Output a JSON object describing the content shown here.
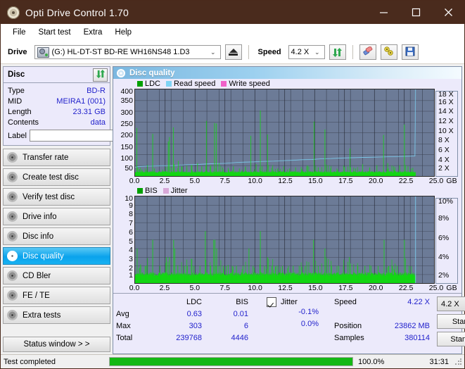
{
  "window": {
    "title": "Opti Drive Control 1.70",
    "icon": "disc-icon",
    "minimize": "─",
    "maximize": "☐",
    "close": "✕",
    "titlebar_color": "#4a2b1d"
  },
  "menu": {
    "items": [
      {
        "label": "File",
        "name": "menu-file"
      },
      {
        "label": "Start test",
        "name": "menu-start-test"
      },
      {
        "label": "Extra",
        "name": "menu-extra"
      },
      {
        "label": "Help",
        "name": "menu-help"
      }
    ]
  },
  "toolbar": {
    "drive_label": "Drive",
    "drive_value": "(G:)   HL-DT-ST BD-RE  WH16NS48 1.D3",
    "eject_icon": "eject-icon",
    "speed_label": "Speed",
    "speed_value": "4.2 X",
    "refresh_icon": "refresh-icon",
    "erase_icon": "eraser-icon",
    "tools_icon": "wrench-icon",
    "save_icon": "floppy-save-icon",
    "caret": "⌄"
  },
  "disc_panel": {
    "title": "Disc",
    "refresh_icon": "refresh-arrows-icon",
    "rows": [
      {
        "key": "Type",
        "value": "BD-R"
      },
      {
        "key": "MID",
        "value": "MEIRA1 (001)"
      },
      {
        "key": "Length",
        "value": "23.31 GB"
      },
      {
        "key": "Contents",
        "value": "data"
      }
    ],
    "label_key": "Label",
    "label_value": "",
    "label_placeholder": "",
    "disc_icon": "cd-disc-icon"
  },
  "nav": {
    "items": [
      {
        "label": "Transfer rate",
        "name": "nav-transfer-rate",
        "active": false
      },
      {
        "label": "Create test disc",
        "name": "nav-create-test-disc",
        "active": false
      },
      {
        "label": "Verify test disc",
        "name": "nav-verify-test-disc",
        "active": false
      },
      {
        "label": "Drive info",
        "name": "nav-drive-info",
        "active": false
      },
      {
        "label": "Disc info",
        "name": "nav-disc-info",
        "active": false
      },
      {
        "label": "Disc quality",
        "name": "nav-disc-quality",
        "active": true
      },
      {
        "label": "CD Bler",
        "name": "nav-cd-bler",
        "active": false
      },
      {
        "label": "FE / TE",
        "name": "nav-fe-te",
        "active": false
      },
      {
        "label": "Extra tests",
        "name": "nav-extra-tests",
        "active": false
      }
    ],
    "status_window": "Status window > >"
  },
  "panel": {
    "title": "Disc quality",
    "icon": "disc-quality-icon"
  },
  "chart_data": [
    {
      "type": "line",
      "name": "ldc-chart",
      "title": "",
      "xlabel": "GB",
      "ylabel": "",
      "xlim": [
        0,
        25
      ],
      "ylim": [
        0,
        400
      ],
      "y2lim": [
        0,
        18
      ],
      "grid": true,
      "legend_position": "top-left",
      "legend": [
        {
          "label": "LDC",
          "color": "#00a000"
        },
        {
          "label": "Read speed",
          "color": "#7fd4f5"
        },
        {
          "label": "Write speed",
          "color": "#f060c8"
        }
      ],
      "xticks": [
        "0.0",
        "2.5",
        "5.0",
        "7.5",
        "10.0",
        "12.5",
        "15.0",
        "17.5",
        "20.0",
        "22.5",
        "25.0"
      ],
      "yticks": [
        "400",
        "350",
        "300",
        "250",
        "200",
        "150",
        "100",
        "50"
      ],
      "y2ticks": [
        "18 X",
        "16 X",
        "14 X",
        "12 X",
        "10 X",
        "8 X",
        "6 X",
        "4 X",
        "2 X"
      ],
      "series": [
        {
          "name": "Read speed",
          "color": "#7fd4f5",
          "x": [
            0.0,
            0.3,
            0.8,
            1.5,
            2.6,
            3.4,
            4.2,
            5.0,
            5.9,
            6.8,
            7.6,
            8.4,
            9.2,
            10.0,
            10.8,
            11.6,
            12.4,
            13.2,
            14.0,
            14.8,
            15.6,
            16.4,
            17.2,
            18.0,
            18.8,
            19.6,
            20.4,
            21.2,
            22.0,
            22.8,
            23.4,
            23.45
          ],
          "values": [
            1.8,
            2.0,
            2.05,
            2.1,
            2.15,
            2.2,
            2.35,
            2.4,
            2.5,
            2.6,
            2.65,
            2.8,
            2.9,
            2.95,
            3.05,
            3.1,
            3.2,
            3.3,
            3.4,
            3.45,
            3.6,
            3.65,
            3.75,
            3.8,
            3.85,
            3.9,
            3.95,
            4.0,
            4.05,
            4.1,
            4.15,
            18.0
          ]
        },
        {
          "name": "LDC",
          "color": "#13d613",
          "baseline": 18,
          "x_end": 23.45,
          "spikes": [
            [
              0.12,
              222
            ],
            [
              0.2,
              40
            ],
            [
              0.55,
              30
            ],
            [
              0.9,
              28
            ],
            [
              1.45,
              195
            ],
            [
              1.6,
              35
            ],
            [
              2.3,
              30
            ],
            [
              2.75,
              160
            ],
            [
              2.85,
              180
            ],
            [
              3.0,
              40
            ],
            [
              3.18,
              225
            ],
            [
              3.25,
              55
            ],
            [
              3.6,
              70
            ],
            [
              3.9,
              45
            ],
            [
              4.3,
              38
            ],
            [
              4.7,
              30
            ],
            [
              5.2,
              60
            ],
            [
              5.55,
              45
            ],
            [
              5.95,
              255
            ],
            [
              6.3,
              50
            ],
            [
              6.62,
              245
            ],
            [
              6.78,
              243
            ],
            [
              7.0,
              60
            ],
            [
              7.3,
              40
            ],
            [
              7.8,
              30
            ],
            [
              8.2,
              45
            ],
            [
              8.7,
              35
            ],
            [
              9.2,
              40
            ],
            [
              9.65,
              186
            ],
            [
              10.1,
              55
            ],
            [
              10.45,
              303
            ],
            [
              10.6,
              45
            ],
            [
              11.05,
              192
            ],
            [
              11.4,
              38
            ],
            [
              11.9,
              32
            ],
            [
              12.4,
              45
            ],
            [
              12.9,
              35
            ],
            [
              13.4,
              40
            ],
            [
              13.9,
              30
            ],
            [
              14.4,
              50
            ],
            [
              14.95,
              252
            ],
            [
              15.3,
              40
            ],
            [
              15.85,
              215
            ],
            [
              16.3,
              35
            ],
            [
              16.9,
              30
            ],
            [
              17.5,
              42
            ],
            [
              17.95,
              127
            ],
            [
              18.4,
              35
            ],
            [
              19.0,
              55
            ],
            [
              19.6,
              40
            ],
            [
              20.2,
              50
            ],
            [
              20.75,
              190
            ],
            [
              21.1,
              60
            ],
            [
              21.6,
              45
            ],
            [
              22.1,
              50
            ],
            [
              22.5,
              238
            ],
            [
              22.8,
              45
            ],
            [
              23.2,
              38
            ]
          ]
        }
      ]
    },
    {
      "type": "line",
      "name": "bis-chart",
      "title": "",
      "xlabel": "GB",
      "ylabel": "",
      "xlim": [
        0,
        25
      ],
      "ylim": [
        0,
        10
      ],
      "y2lim": [
        0,
        10
      ],
      "grid": true,
      "legend_position": "top-left",
      "legend": [
        {
          "label": "BIS",
          "color": "#00a000"
        },
        {
          "label": "Jitter",
          "color": "#d8a8d8"
        }
      ],
      "xticks": [
        "0.0",
        "2.5",
        "5.0",
        "7.5",
        "10.0",
        "12.5",
        "15.0",
        "17.5",
        "20.0",
        "22.5",
        "25.0"
      ],
      "yticks": [
        "10",
        "9",
        "8",
        "7",
        "6",
        "5",
        "4",
        "3",
        "2",
        "1"
      ],
      "y2ticks": [
        "10%",
        "8%",
        "6%",
        "4%",
        "2%"
      ],
      "series": [
        {
          "name": "BIS",
          "color": "#13d613",
          "baseline": 1,
          "x_end": 23.45,
          "spikes": [
            [
              0.15,
              4
            ],
            [
              0.45,
              2
            ],
            [
              0.9,
              2
            ],
            [
              1.45,
              5
            ],
            [
              2.05,
              2
            ],
            [
              2.6,
              3
            ],
            [
              2.85,
              3
            ],
            [
              3.2,
              5
            ],
            [
              3.3,
              4
            ],
            [
              3.55,
              2
            ],
            [
              4.1,
              2
            ],
            [
              4.35,
              2
            ],
            [
              4.9,
              2
            ],
            [
              5.4,
              2
            ],
            [
              5.85,
              6
            ],
            [
              6.3,
              2
            ],
            [
              6.55,
              5
            ],
            [
              6.65,
              5
            ],
            [
              6.8,
              4
            ],
            [
              7.0,
              2
            ],
            [
              7.35,
              2
            ],
            [
              7.6,
              2
            ],
            [
              8.1,
              2
            ],
            [
              8.45,
              2
            ],
            [
              9.0,
              2
            ],
            [
              9.5,
              4
            ],
            [
              9.85,
              2
            ],
            [
              10.45,
              6
            ],
            [
              10.8,
              2
            ],
            [
              11.05,
              3
            ],
            [
              11.4,
              2
            ],
            [
              11.75,
              2
            ],
            [
              12.3,
              2
            ],
            [
              12.8,
              2
            ],
            [
              13.2,
              2
            ],
            [
              13.7,
              2
            ],
            [
              14.2,
              2
            ],
            [
              14.9,
              5
            ],
            [
              15.3,
              2
            ],
            [
              15.85,
              4
            ],
            [
              16.4,
              2
            ],
            [
              17.0,
              2
            ],
            [
              17.4,
              2
            ],
            [
              17.9,
              3
            ],
            [
              18.6,
              2
            ],
            [
              19.2,
              2
            ],
            [
              19.7,
              2
            ],
            [
              20.3,
              2
            ],
            [
              20.8,
              5
            ],
            [
              21.2,
              2
            ],
            [
              21.5,
              2
            ],
            [
              21.9,
              2
            ],
            [
              22.5,
              5
            ],
            [
              22.9,
              2
            ]
          ]
        }
      ]
    }
  ],
  "stats": {
    "col_headers": [
      "LDC",
      "BIS"
    ],
    "rows": [
      {
        "label": "Avg",
        "ldc": "0.63",
        "bis": "0.01",
        "jitter": "-0.1%"
      },
      {
        "label": "Max",
        "ldc": "303",
        "bis": "6",
        "jitter": "0.0%"
      },
      {
        "label": "Total",
        "ldc": "239768",
        "bis": "4446",
        "jitter": ""
      }
    ],
    "jitter_label": "Jitter",
    "jitter_checked": true,
    "speed_key": "Speed",
    "speed_value": "4.22 X",
    "position_key": "Position",
    "position_value": "23862 MB",
    "samples_key": "Samples",
    "samples_value": "380114",
    "speed_select": "4.2 X",
    "caret": "⌄",
    "start_full": "Start full",
    "start_part": "Start part"
  },
  "statusbar": {
    "message": "Test completed",
    "progress_percent": 100,
    "percent_label": "100.0%",
    "elapsed": "31:31",
    "bar_color": "#14b814"
  }
}
